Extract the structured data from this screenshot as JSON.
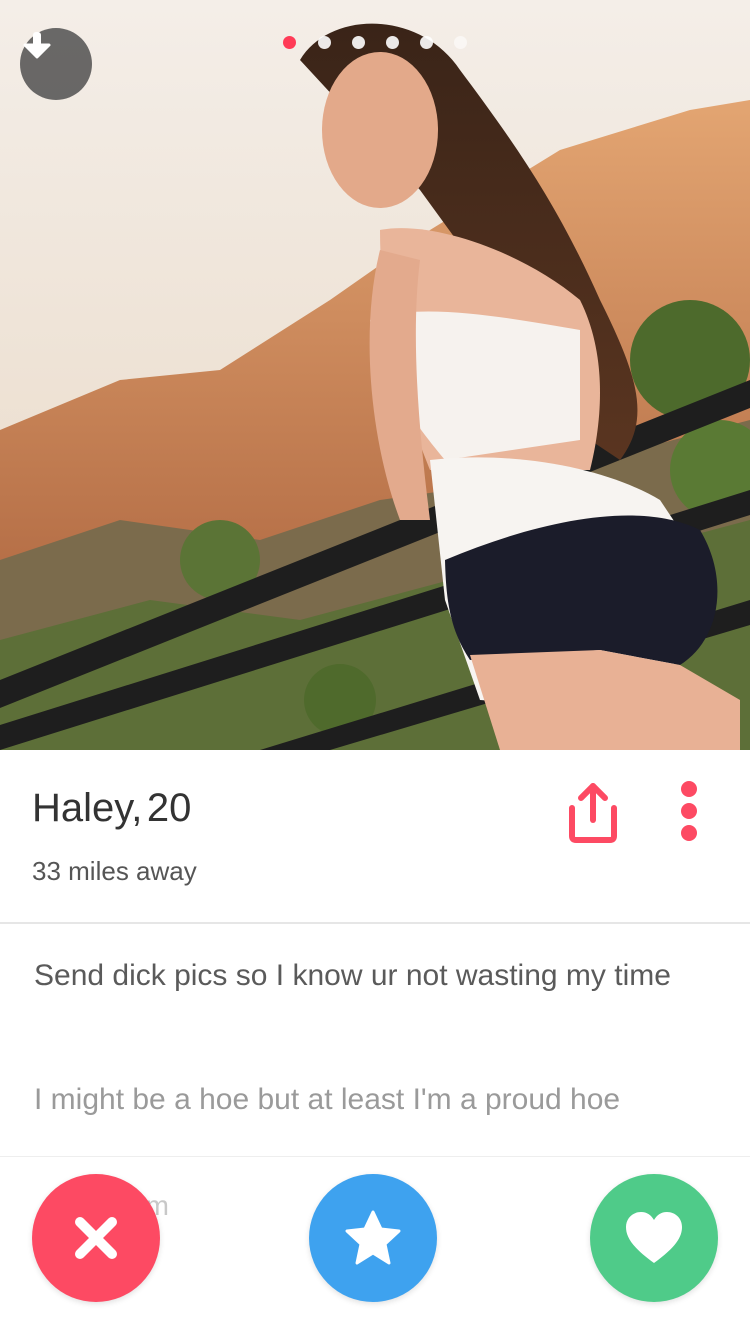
{
  "profile": {
    "name": "Haley,",
    "age": "20",
    "distance": "33 miles away"
  },
  "bio": {
    "line1": "Send dick pics so I know ur not wasting my time",
    "line2": "I might be a hoe but at least I'm a proud hoe",
    "peek": "em"
  },
  "photo_pager": {
    "total": 6,
    "active_index": 0
  },
  "colors": {
    "accent": "#fd4a63",
    "super_like": "#3ea2ef",
    "like": "#4fcb89",
    "pager_active": "#ff3b57"
  },
  "icons": {
    "download": "download-icon",
    "share": "share-icon",
    "more": "more-vertical-icon",
    "nope": "close-icon",
    "super_like": "star-icon",
    "like": "heart-icon"
  }
}
